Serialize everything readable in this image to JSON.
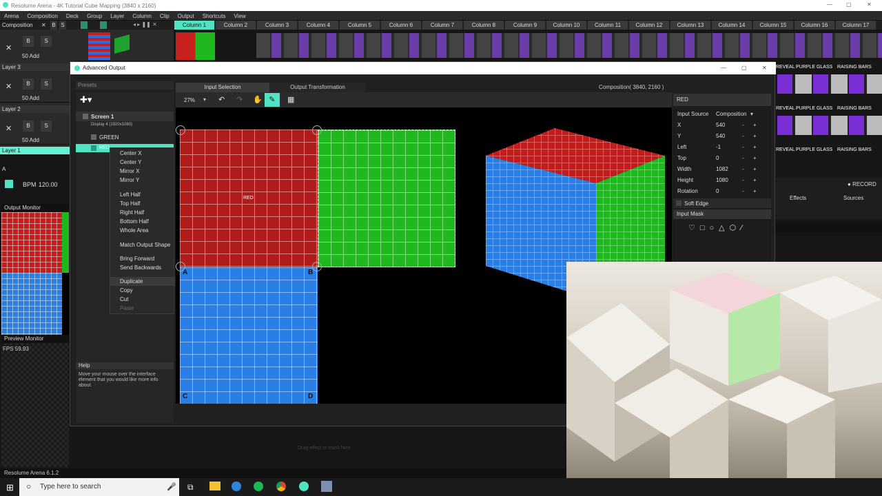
{
  "window": {
    "title": "Resolume Arena - 4K Tutorial Cube Mapping (3840 x 2160)"
  },
  "menu": [
    "Arena",
    "Composition",
    "Deck",
    "Group",
    "Layer",
    "Column",
    "Clip",
    "Output",
    "Shortcuts",
    "View"
  ],
  "composition_label": "Composition",
  "columns": [
    "Column 1",
    "Column 2",
    "Column 3",
    "Column 4",
    "Column 5",
    "Column 6",
    "Column 7",
    "Column 8",
    "Column 9",
    "Column 10",
    "Column 11",
    "Column 12",
    "Column 13",
    "Column 14",
    "Column 15",
    "Column 16",
    "Column 17"
  ],
  "layers": [
    {
      "name": "Layer 3",
      "mode": "50 Add"
    },
    {
      "name": "Layer 2",
      "mode": "50 Add"
    },
    {
      "name": "Layer 1",
      "mode": "50 Add"
    }
  ],
  "layer_btns": {
    "x": "×",
    "b": "B",
    "s": "S"
  },
  "clip_labels": [
    "REVEAL",
    "PURPLE GLASS",
    "RAISING BARS"
  ],
  "bpm": {
    "label": "BPM",
    "value": "120.00"
  },
  "record": "RECORD",
  "effects_tab": "Effects",
  "sources_tab": "Sources",
  "output_monitor": "Output Monitor",
  "preview_monitor": "Preview Monitor",
  "fps": "FPS 59.93",
  "version": "Resolume Arena 6.1.2",
  "dialog": {
    "title": "Advanced Output",
    "presets": "Presets",
    "tab_input": "Input Selection",
    "tab_output": "Output Transformation",
    "composition_size": "Composition( 3840, 2160 )",
    "zoom": "27%"
  },
  "tree": {
    "screen": "Screen 1",
    "display": "Display 4 (1920x1080)",
    "slices": [
      "GREEN",
      "RED"
    ]
  },
  "context_menu": [
    "Center X",
    "Center Y",
    "Mirror X",
    "Mirror Y",
    "Left Half",
    "Top Half",
    "Right Half",
    "Bottom Half",
    "Whole Area",
    "Match Output Shape",
    "Bring Forward",
    "Send Backwards",
    "Duplicate",
    "Copy",
    "Cut",
    "Paste"
  ],
  "help": {
    "title": "Help",
    "text": "Move your mouse over the interface element that you would like more info about."
  },
  "slice_text": "RED",
  "corner_labels": {
    "a": "A",
    "b": "B",
    "c": "C",
    "d": "D"
  },
  "props": {
    "title": "RED",
    "input_source_label": "Input Source",
    "input_source": "Composition",
    "rows": [
      {
        "k": "X",
        "v": "540"
      },
      {
        "k": "Y",
        "v": "540"
      },
      {
        "k": "Left",
        "v": "-1"
      },
      {
        "k": "Top",
        "v": "0"
      },
      {
        "k": "Width",
        "v": "1082"
      },
      {
        "k": "Height",
        "v": "1080"
      },
      {
        "k": "Rotation",
        "v": "0"
      }
    ],
    "soft_edge": "Soft Edge",
    "input_mask": "Input Mask"
  },
  "drop_hint": "Drag effect or mask here",
  "taskbar": {
    "search": "Type here to search"
  },
  "colors": {
    "accent": "#4fe3c3",
    "red": "#b01c1c",
    "green": "#1fb81f",
    "blue": "#2a7fe6"
  }
}
